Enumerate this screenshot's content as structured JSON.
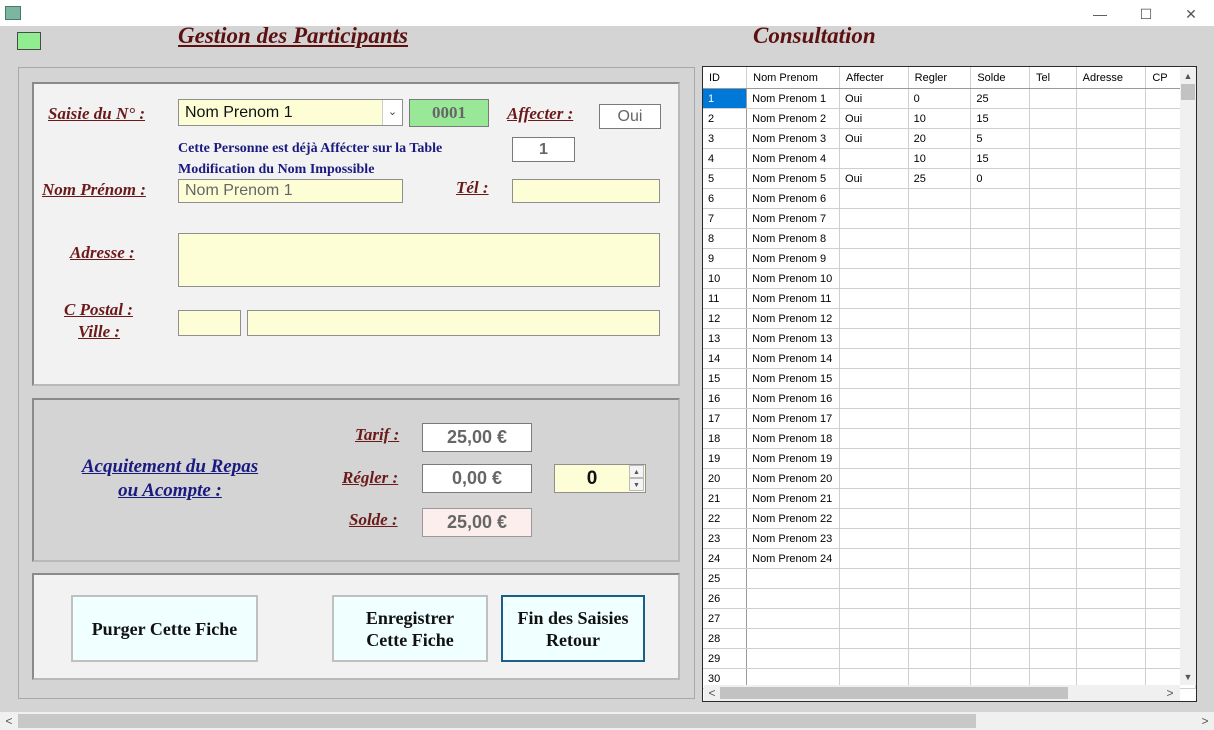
{
  "window": {
    "minimize": "—",
    "maximize": "☐",
    "close": "✕"
  },
  "titles": {
    "gestion": "Gestion des Participants",
    "consultation": "Consultation"
  },
  "saisie": {
    "label": "Saisie du N° :",
    "combo_value": "Nom Prenom 1",
    "number": "0001",
    "affecter_label": "Affecter :",
    "affecter_value": "Oui",
    "table_number": "1",
    "message_line1": "Cette Personne est déjà Affécter sur la Table",
    "message_line2": "Modification du Nom Impossible",
    "nom_label": "Nom Prénom :",
    "nom_value": "Nom Prenom 1",
    "tel_label": "Tél :",
    "tel_value": "",
    "adresse_label": "Adresse  :",
    "adresse_value": "",
    "cpostal_label": "C Postal :",
    "ville_label": "Ville :",
    "cpostal_value": "",
    "ville_value": ""
  },
  "paiement": {
    "title_line1": "Acquitement du Repas",
    "title_line2": "ou Acompte :",
    "tarif_label": "Tarif :",
    "tarif_value": "25,00 €",
    "regler_label": "Régler :",
    "regler_value": "0,00 €",
    "stepper_value": "0",
    "solde_label": "Solde :",
    "solde_value": "25,00 €"
  },
  "buttons": {
    "purger": "Purger Cette Fiche",
    "enregistrer_line1": "Enregistrer",
    "enregistrer_line2": "Cette Fiche",
    "fin_line1": "Fin des Saisies",
    "fin_line2": "Retour"
  },
  "grid": {
    "columns": [
      "ID",
      "Nom Prenom",
      "Affecter",
      "Regler",
      "Solde",
      "Tel",
      "Adresse",
      "CP"
    ],
    "rows": [
      [
        "1",
        "Nom Prenom 1",
        "Oui",
        "0",
        "25",
        "",
        "",
        ""
      ],
      [
        "2",
        "Nom Prenom 2",
        "Oui",
        "10",
        "15",
        "",
        "",
        ""
      ],
      [
        "3",
        "Nom Prenom 3",
        "Oui",
        "20",
        "5",
        "",
        "",
        ""
      ],
      [
        "4",
        "Nom Prenom 4",
        "",
        "10",
        "15",
        "",
        "",
        ""
      ],
      [
        "5",
        "Nom Prenom 5",
        "Oui",
        "25",
        "0",
        "",
        "",
        ""
      ],
      [
        "6",
        "Nom Prenom 6",
        "",
        "",
        "",
        "",
        "",
        ""
      ],
      [
        "7",
        "Nom Prenom 7",
        "",
        "",
        "",
        "",
        "",
        ""
      ],
      [
        "8",
        "Nom Prenom 8",
        "",
        "",
        "",
        "",
        "",
        ""
      ],
      [
        "9",
        "Nom Prenom 9",
        "",
        "",
        "",
        "",
        "",
        ""
      ],
      [
        "10",
        "Nom Prenom 10",
        "",
        "",
        "",
        "",
        "",
        ""
      ],
      [
        "11",
        "Nom Prenom 11",
        "",
        "",
        "",
        "",
        "",
        ""
      ],
      [
        "12",
        "Nom Prenom 12",
        "",
        "",
        "",
        "",
        "",
        ""
      ],
      [
        "13",
        "Nom Prenom 13",
        "",
        "",
        "",
        "",
        "",
        ""
      ],
      [
        "14",
        "Nom Prenom 14",
        "",
        "",
        "",
        "",
        "",
        ""
      ],
      [
        "15",
        "Nom Prenom 15",
        "",
        "",
        "",
        "",
        "",
        ""
      ],
      [
        "16",
        "Nom Prenom 16",
        "",
        "",
        "",
        "",
        "",
        ""
      ],
      [
        "17",
        "Nom Prenom 17",
        "",
        "",
        "",
        "",
        "",
        ""
      ],
      [
        "18",
        "Nom Prenom 18",
        "",
        "",
        "",
        "",
        "",
        ""
      ],
      [
        "19",
        "Nom Prenom 19",
        "",
        "",
        "",
        "",
        "",
        ""
      ],
      [
        "20",
        "Nom Prenom 20",
        "",
        "",
        "",
        "",
        "",
        ""
      ],
      [
        "21",
        "Nom Prenom 21",
        "",
        "",
        "",
        "",
        "",
        ""
      ],
      [
        "22",
        "Nom Prenom 22",
        "",
        "",
        "",
        "",
        "",
        ""
      ],
      [
        "23",
        "Nom Prenom 23",
        "",
        "",
        "",
        "",
        "",
        ""
      ],
      [
        "24",
        "Nom Prenom 24",
        "",
        "",
        "",
        "",
        "",
        ""
      ],
      [
        "25",
        "",
        "",
        "",
        "",
        "",
        "",
        ""
      ],
      [
        "26",
        "",
        "",
        "",
        "",
        "",
        "",
        ""
      ],
      [
        "27",
        "",
        "",
        "",
        "",
        "",
        "",
        ""
      ],
      [
        "28",
        "",
        "",
        "",
        "",
        "",
        "",
        ""
      ],
      [
        "29",
        "",
        "",
        "",
        "",
        "",
        "",
        ""
      ],
      [
        "30",
        "",
        "",
        "",
        "",
        "",
        "",
        ""
      ]
    ]
  },
  "scroll": {
    "up": "▲",
    "down": "▼",
    "left": "<",
    "right": ">",
    "page_left": "<",
    "page_right": ">"
  }
}
